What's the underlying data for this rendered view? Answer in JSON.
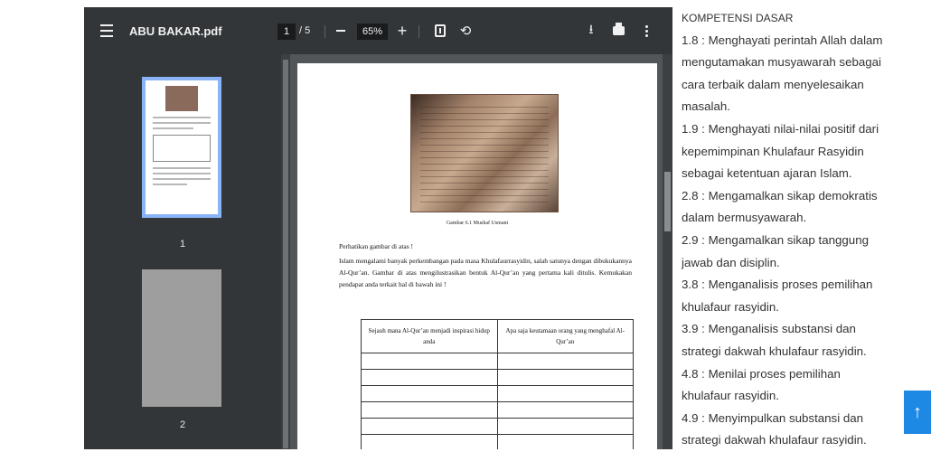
{
  "viewer": {
    "title": "ABU BAKAR.pdf",
    "page_current": "1",
    "page_sep": "/ 5",
    "zoom": "65%",
    "zoom_in": "+",
    "rotate_glyph": "⟲",
    "download_glyph": "⭳",
    "thumbnails": [
      {
        "label": "1"
      },
      {
        "label": "2"
      }
    ],
    "document": {
      "caption": "Gambar 6.1 Mushaf Usmani",
      "para1": "Perhatikan gambar di atas !",
      "para2": "Islam mengalami banyak perkembangan pada masa Khulafaurrasyidin, salah satunya dengan dibukukannya Al-Qur’an. Gambar di atas mengilustrasikan bentuk Al-Qur’an yang pertama kali ditulis. Kemukakan pendapat anda terkait hal di bawah ini !",
      "table_headers": [
        "Sejauh mana Al-Qur’an menjadi inspirasi hidup anda",
        "Apa saja keutamaan orang yang menghafal Al-Qur’an"
      ]
    }
  },
  "side": {
    "heading": "KOMPETENSI DASAR",
    "lines": [
      "1.8 : Menghayati perintah Allah dalam",
      "mengutamakan musyawarah sebagai",
      "cara terbaik dalam menyelesaikan",
      "masalah.",
      "1.9 : Menghayati nilai-nilai positif dari",
      "kepemimpinan Khulafaur Rasyidin",
      "sebagai ketentuan ajaran Islam.",
      "2.8 : Mengamalkan sikap demokratis",
      "dalam bermusyawarah.",
      "2.9 : Mengamalkan sikap tanggung",
      "jawab dan disiplin.",
      "3.8 : Menganalisis proses pemilihan",
      "khulafaur rasyidin.",
      "3.9 : Menganalisis substansi dan",
      "strategi dakwah khulafaur rasyidin.",
      "4.8 : Menilai proses pemilihan",
      "khulafaur rasyidin.",
      "4.9 : Menyimpulkan substansi dan",
      "strategi dakwah khulafaur rasyidin."
    ]
  },
  "back_to_top": "↑"
}
